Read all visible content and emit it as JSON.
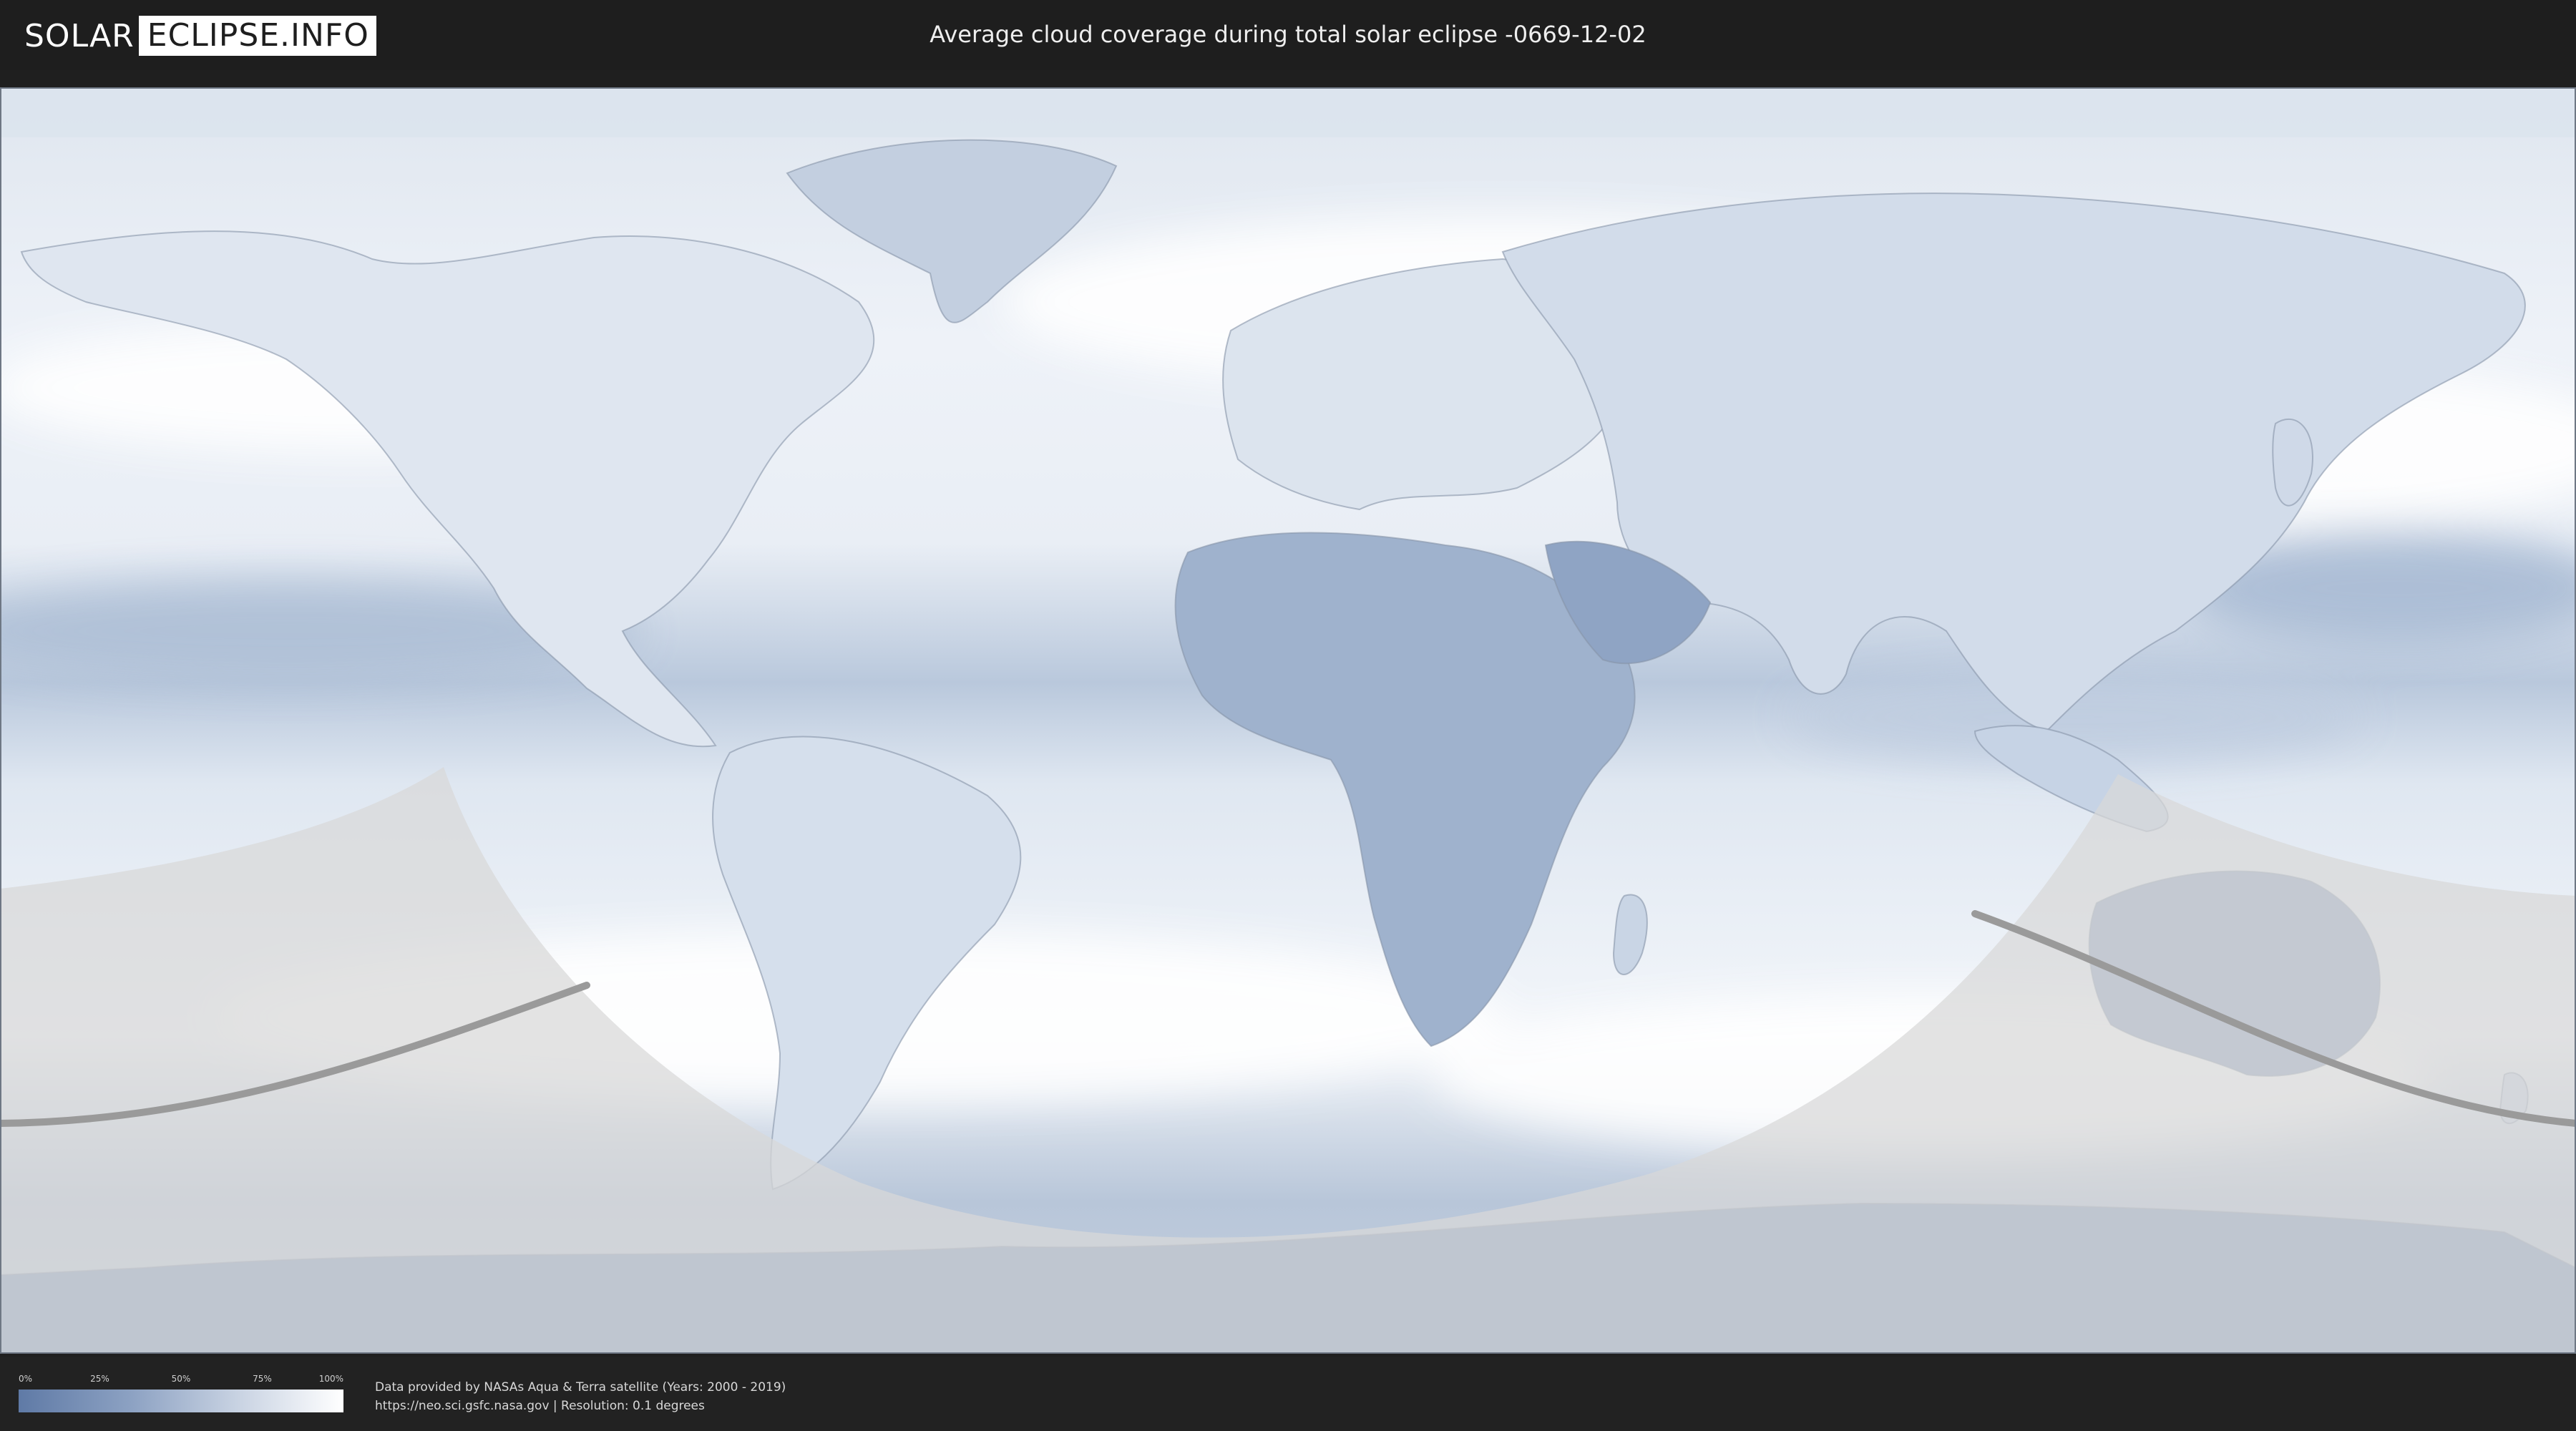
{
  "header": {
    "logo_left": "SOLAR",
    "logo_right": "ECLIPSE.INFO",
    "title": "Average cloud coverage during total solar eclipse -0669-12-02"
  },
  "legend": {
    "ticks": [
      "0%",
      "25%",
      "50%",
      "75%",
      "100%"
    ],
    "tick_values": [
      0,
      25,
      50,
      75,
      100
    ],
    "gradient_colors": [
      "#5f7aa6",
      "#8da2c3",
      "#c4cfe0",
      "#ffffff"
    ]
  },
  "footer": {
    "credit_line": "Data provided by NASAs Aqua & Terra satellite (Years: 2000 - 2019)",
    "source_line": "https://neo.sci.gsfc.nasa.gov | Resolution: 0.1 degrees"
  },
  "colors": {
    "cloud_low": "#5f7aa6",
    "cloud_high": "#ffffff",
    "night_shade": "#d6d6d6",
    "eclipse_path": "#9a9a9a"
  }
}
